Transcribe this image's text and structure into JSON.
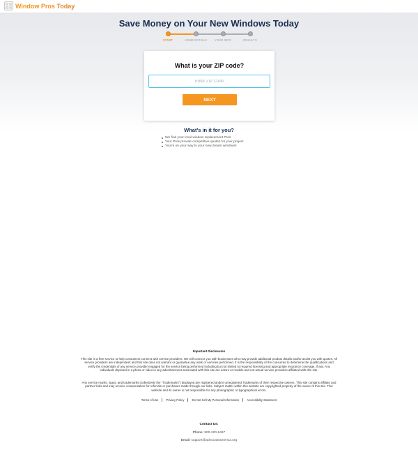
{
  "brand": {
    "part1": "Window Pros",
    "part2": "Today"
  },
  "headline": "Save Money on Your New Windows Today",
  "steps": [
    "START",
    "HOME DETAILS",
    "YOUR INFO",
    "RESULTS"
  ],
  "card": {
    "title": "What is your ZIP code?",
    "zip_placeholder": "Enter ZIP Code",
    "zip_value": "",
    "next_label": "NEXT"
  },
  "benefits": {
    "title": "What's in it for you?",
    "items": [
      "We find your local window replacement Pros",
      "Your Pros provide competitive quotes for your project",
      "You're on your way to your new dream windows!"
    ]
  },
  "disclosures": {
    "title": "Important Disclosures",
    "p1": "This site is a free service to help consumers connect with service providers. We will connect you with businesses who may provide additional product details and/or assist you with quotes. All service providers are independent and this site does not warrant or guarantee any work or services performed. It is the responsibility of the consumer to determine the qualifications and verify the credentials of any service provider engaged for the service being performed including but not limited to required licensing and appropriate insurance coverage, if any.  Any individuals depicted in a photo or video in any advertisement associated with this site are actors or models and not actual service providers affiliated with this site.",
    "p2": "Any service marks, logos, and trademarks (collectively the \"Trademarks\") displayed are registered and/or unregistered Trademarks of their respective owners. This site contains affiliate and partner links and may receive compensation for referrals or purchases made through our links. Subject matter within this website are copyrighted property of the owner of this site.  This website and its owner is not responsible for any photographic or typographical errors."
  },
  "footer_links": [
    "Terms of Use",
    "Privacy Policy",
    "Do Not Sell My Personal Information",
    "Accessibility Statement"
  ],
  "contact": {
    "title": "Contact Us:",
    "phone_label": "Phone:",
    "phone": "800-220-5467",
    "email_label": "Email:",
    "email": "support@advocateamerica.org"
  }
}
